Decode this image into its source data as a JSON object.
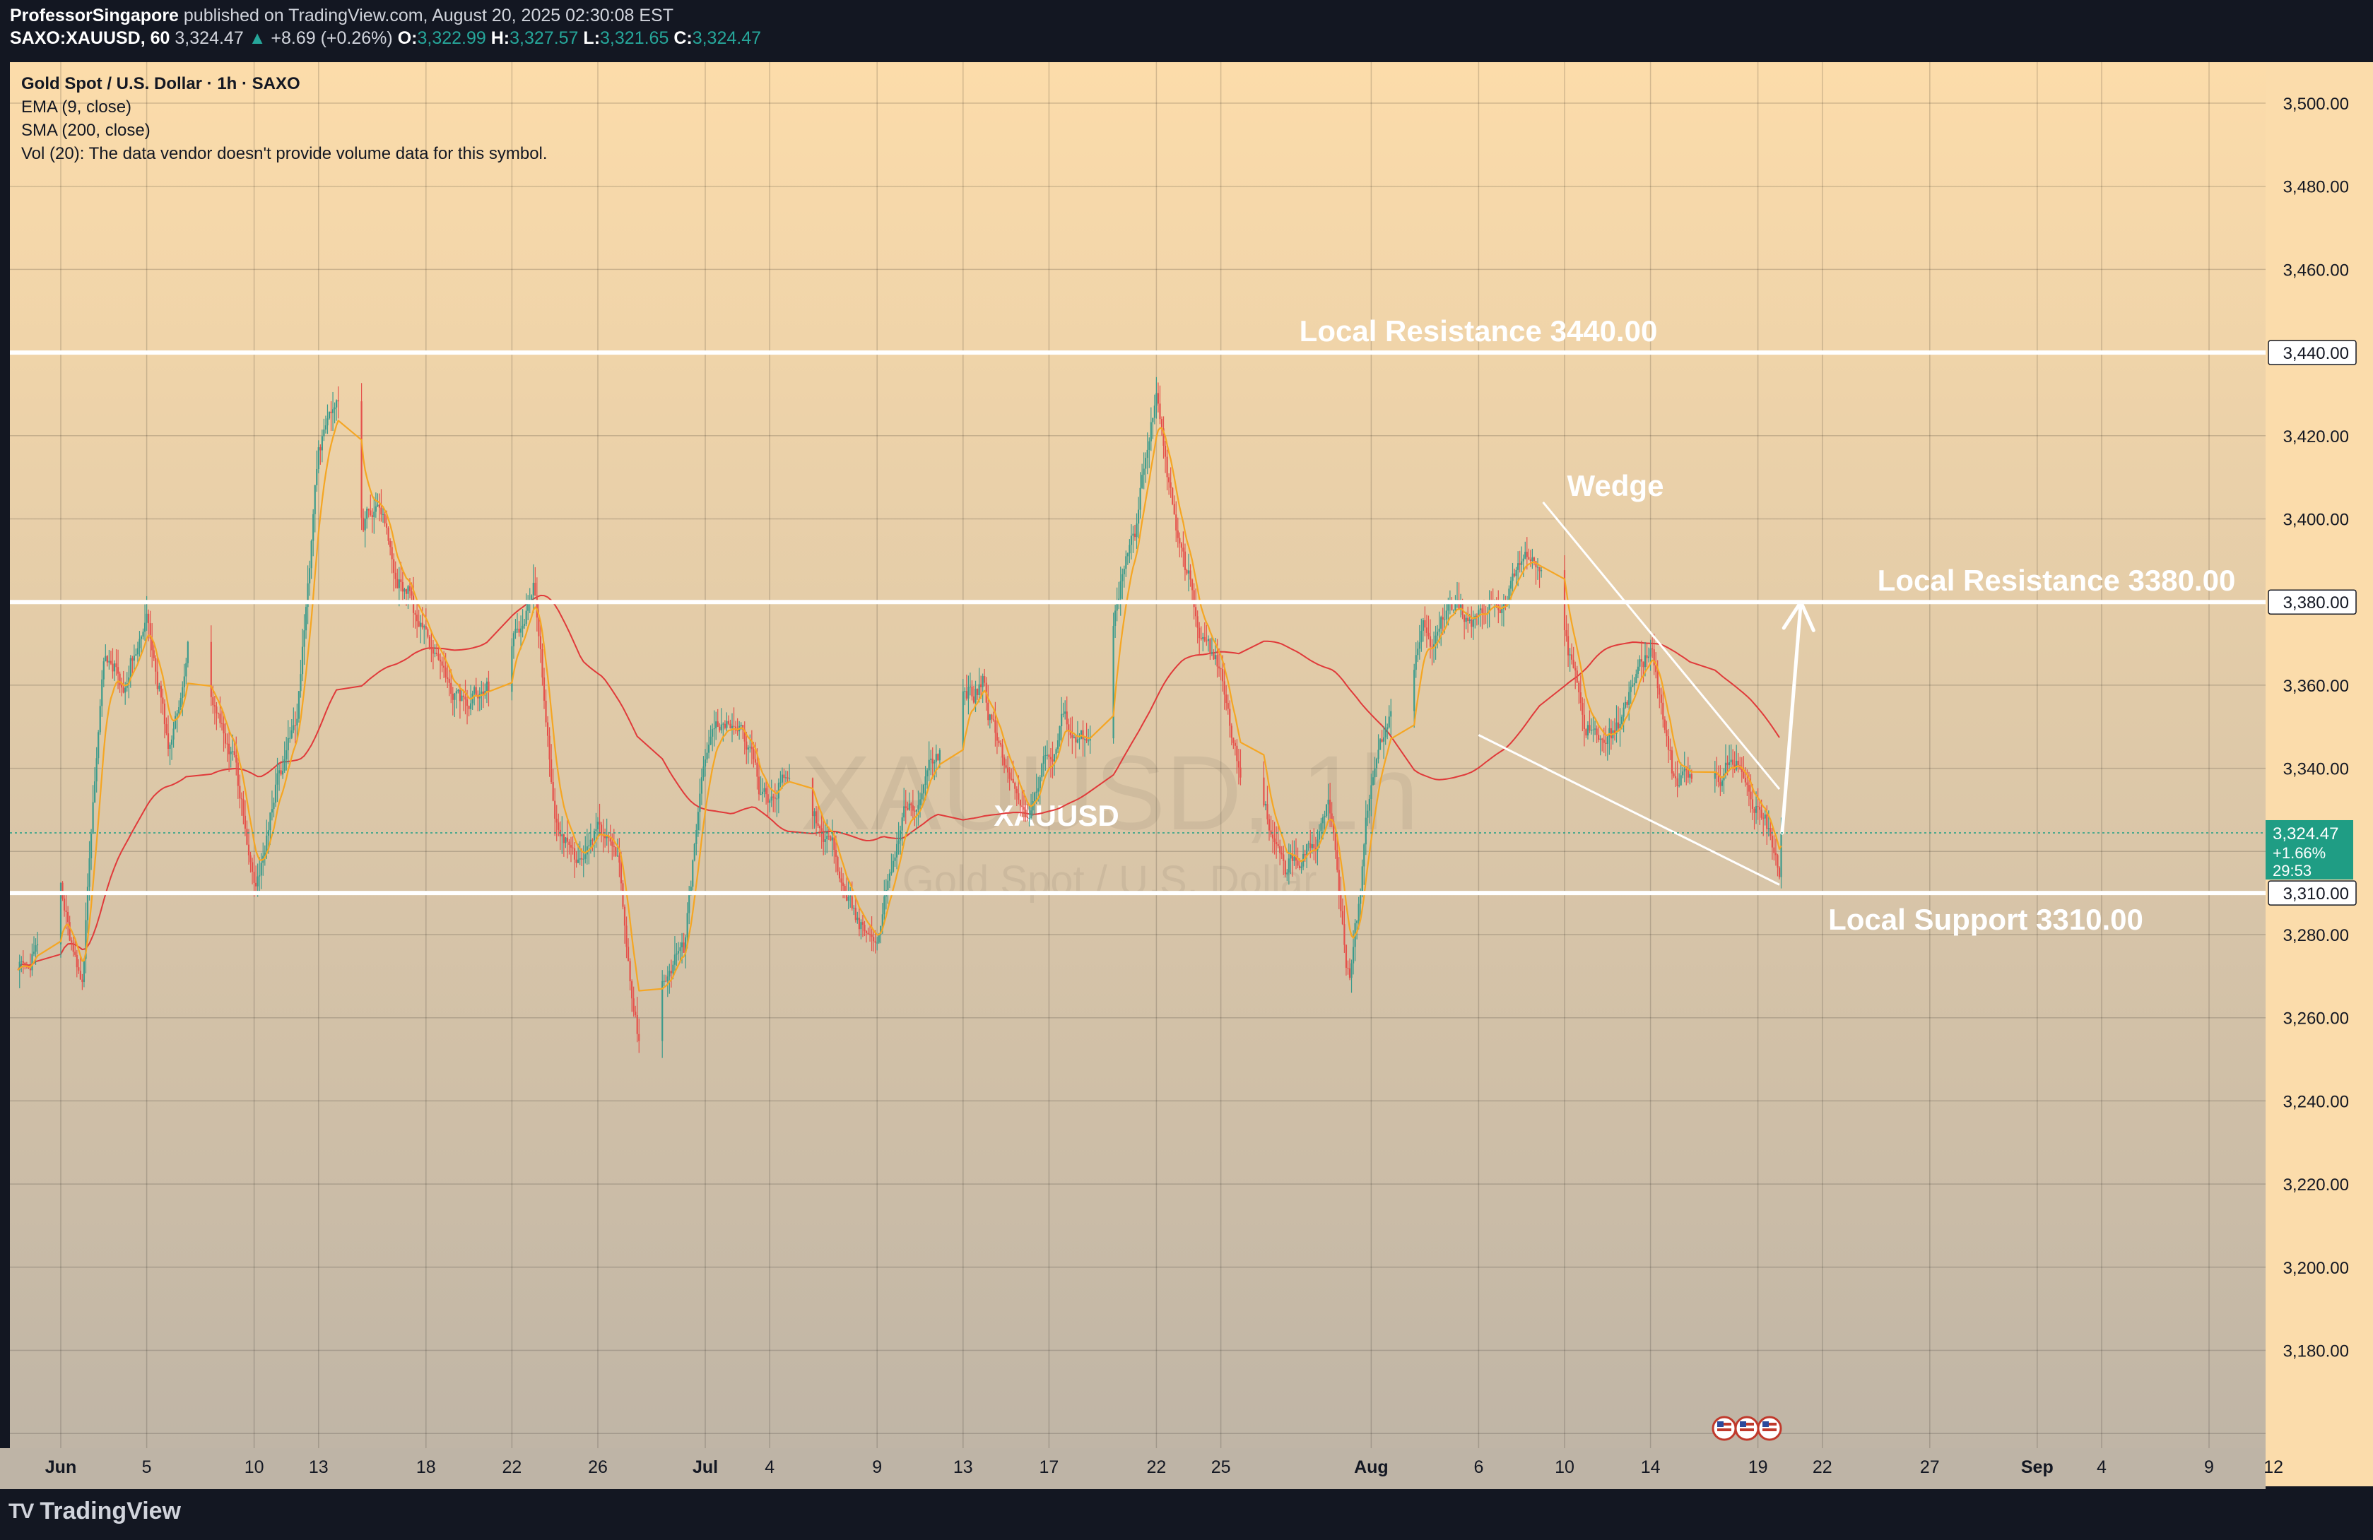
{
  "header": {
    "author": "ProfessorSingapore",
    "published": "published on TradingView.com, August 20, 2025 02:30:08 EST",
    "symbol": "SAXO:XAUUSD, 60",
    "last": "3,324.47",
    "arrow": "▲",
    "change": "+8.69 (+0.26%)",
    "o_label": "O:",
    "o": "3,322.99",
    "h_label": "H:",
    "h": "3,327.57",
    "l_label": "L:",
    "l": "3,321.65",
    "c_label": "C:",
    "c": "3,324.47"
  },
  "legend": {
    "title": "Gold Spot / U.S. Dollar · 1h · SAXO",
    "ema": "EMA (9, close)",
    "sma": "SMA (200, close)",
    "vol": "Vol (20): The data vendor doesn't provide volume data for this symbol."
  },
  "footer": {
    "brand": "TradingView",
    "logo_icon": "tradingview-logo-icon"
  },
  "colors": {
    "bg_top": "#fcdcaa",
    "bg_bottom": "#beb4a6",
    "up": "#3d9b8c",
    "down": "#e5514b",
    "ema": "#f5a623",
    "sma": "#e03a3a",
    "level": "#ffffff",
    "price_tag": "#1f9d84"
  },
  "chart_data": {
    "type": "candlestick",
    "watermark": {
      "symbol": "XAUUSD, 1h",
      "name": "Gold Spot / U.S. Dollar",
      "center_label": "XAUUSD"
    },
    "y_ticks": [
      3500,
      3480,
      3460,
      3440,
      3420,
      3400,
      3380,
      3360,
      3340,
      3320,
      3300,
      3280,
      3260,
      3240,
      3220,
      3200,
      3180
    ],
    "y_tick_labels": [
      "3,500.00",
      "3,480.00",
      "3,460.00",
      "3,440.00",
      "3,420.00",
      "3,400.00",
      "3,380.00",
      "3,360.00",
      "3,340.00",
      "3,324.47",
      "3,310.00",
      "3,300.00",
      "3,280.00",
      "3,260.00",
      "3,240.00",
      "3,220.00",
      "3,200.00",
      "3,180.00"
    ],
    "y_axis_labels": [
      "3,500.00",
      "3,480.00",
      "3,460.00",
      "3,440.00",
      "3,420.00",
      "3,400.00",
      "3,380.00",
      "3,360.00",
      "3,340.00",
      "3,300.00",
      "3,280.00",
      "3,260.00",
      "3,240.00",
      "3,220.00",
      "3,200.00",
      "3,180.00"
    ],
    "ylim": [
      3175,
      3512
    ],
    "x_ticks": [
      "Jun",
      "5",
      "10",
      "13",
      "18",
      "22",
      "26",
      "Jul",
      "4",
      "9",
      "13",
      "17",
      "22",
      "25",
      "Aug",
      "6",
      "10",
      "14",
      "19",
      "22",
      "27",
      "Sep",
      "4",
      "9",
      "12"
    ],
    "x_tick_dates": [
      "2025-06-01",
      "2025-06-05",
      "2025-06-10",
      "2025-06-13",
      "2025-06-18",
      "2025-06-22",
      "2025-06-26",
      "2025-07-01",
      "2025-07-04",
      "2025-07-09",
      "2025-07-13",
      "2025-07-17",
      "2025-07-22",
      "2025-07-25",
      "2025-08-01",
      "2025-08-06",
      "2025-08-10",
      "2025-08-14",
      "2025-08-19",
      "2025-08-22",
      "2025-08-27",
      "2025-09-01",
      "2025-09-04",
      "2025-09-09",
      "2025-09-12"
    ],
    "price_path": [
      [
        "2025-05-30",
        3290
      ],
      [
        "2025-06-01",
        3315
      ],
      [
        "2025-06-02",
        3285
      ],
      [
        "2025-06-03",
        3372
      ],
      [
        "2025-06-04",
        3360
      ],
      [
        "2025-06-05",
        3385
      ],
      [
        "2025-06-06",
        3345
      ],
      [
        "2025-06-07",
        3372
      ],
      [
        "2025-06-09",
        3340
      ],
      [
        "2025-06-10",
        3310
      ],
      [
        "2025-06-11",
        3330
      ],
      [
        "2025-06-12",
        3350
      ],
      [
        "2025-06-13",
        3420
      ],
      [
        "2025-06-14",
        3430
      ],
      [
        "2025-06-15",
        3400
      ],
      [
        "2025-06-16",
        3400
      ],
      [
        "2025-06-17",
        3385
      ],
      [
        "2025-06-18",
        3375
      ],
      [
        "2025-06-19",
        3365
      ],
      [
        "2025-06-20",
        3355
      ],
      [
        "2025-06-21",
        3355
      ],
      [
        "2025-06-23",
        3380
      ],
      [
        "2025-06-24",
        3330
      ],
      [
        "2025-06-25",
        3320
      ],
      [
        "2025-06-26",
        3330
      ],
      [
        "2025-06-27",
        3315
      ],
      [
        "2025-06-28",
        3272
      ],
      [
        "2025-06-29",
        3290
      ],
      [
        "2025-06-30",
        3300
      ],
      [
        "2025-07-01",
        3340
      ],
      [
        "2025-07-02",
        3352
      ],
      [
        "2025-07-03",
        3345
      ],
      [
        "2025-07-04",
        3330
      ],
      [
        "2025-07-05",
        3338
      ],
      [
        "2025-07-07",
        3320
      ],
      [
        "2025-07-08",
        3305
      ],
      [
        "2025-07-09",
        3295
      ],
      [
        "2025-07-10",
        3322
      ],
      [
        "2025-07-11",
        3335
      ],
      [
        "2025-07-13",
        3358
      ],
      [
        "2025-07-14",
        3360
      ],
      [
        "2025-07-15",
        3340
      ],
      [
        "2025-07-16",
        3330
      ],
      [
        "2025-07-17",
        3340
      ],
      [
        "2025-07-18",
        3348
      ],
      [
        "2025-07-19",
        3350
      ],
      [
        "2025-07-21",
        3398
      ],
      [
        "2025-07-22",
        3430
      ],
      [
        "2025-07-23",
        3400
      ],
      [
        "2025-07-24",
        3370
      ],
      [
        "2025-07-25",
        3360
      ],
      [
        "2025-07-26",
        3338
      ],
      [
        "2025-07-27",
        3332
      ],
      [
        "2025-07-28",
        3312
      ],
      [
        "2025-07-29",
        3320
      ],
      [
        "2025-07-30",
        3330
      ],
      [
        "2025-07-31",
        3290
      ],
      [
        "2025-08-01",
        3340
      ],
      [
        "2025-08-02",
        3355
      ],
      [
        "2025-08-04",
        3372
      ],
      [
        "2025-08-05",
        3375
      ],
      [
        "2025-08-06",
        3375
      ],
      [
        "2025-08-07",
        3382
      ],
      [
        "2025-08-08",
        3395
      ],
      [
        "2025-08-09",
        3395
      ],
      [
        "2025-08-10",
        3380
      ],
      [
        "2025-08-11",
        3352
      ],
      [
        "2025-08-12",
        3345
      ],
      [
        "2025-08-13",
        3355
      ],
      [
        "2025-08-14",
        3365
      ],
      [
        "2025-08-15",
        3342
      ],
      [
        "2025-08-16",
        3335
      ],
      [
        "2025-08-18",
        3340
      ],
      [
        "2025-08-19",
        3330
      ],
      [
        "2025-08-20",
        3315
      ],
      [
        "2025-08-20T03",
        3324.47
      ]
    ],
    "ema_period": 9,
    "sma_period": 200,
    "current_price": 3324.47,
    "current_price_label": "3,324.47",
    "price_tag_change": "+1.66%",
    "price_tag_countdown": "29:53",
    "levels": [
      {
        "name": "Local Resistance 3440.00",
        "price": 3440,
        "label": "3,440.00"
      },
      {
        "name": "Local Resistance 3380.00",
        "price": 3380,
        "label": "3,380.00"
      },
      {
        "name": "Local Support 3310.00",
        "price": 3310,
        "label": "3,310.00"
      }
    ],
    "wedge": {
      "label": "Wedge",
      "upper": [
        [
          "2025-08-09",
          3404
        ],
        [
          "2025-08-20",
          3335
        ]
      ],
      "lower": [
        [
          "2025-08-06",
          3348
        ],
        [
          "2025-08-20",
          3312
        ]
      ],
      "projection": [
        [
          "2025-08-20T03",
          3324.47
        ],
        [
          "2025-08-21",
          3380
        ]
      ]
    },
    "event_markers": 3
  }
}
